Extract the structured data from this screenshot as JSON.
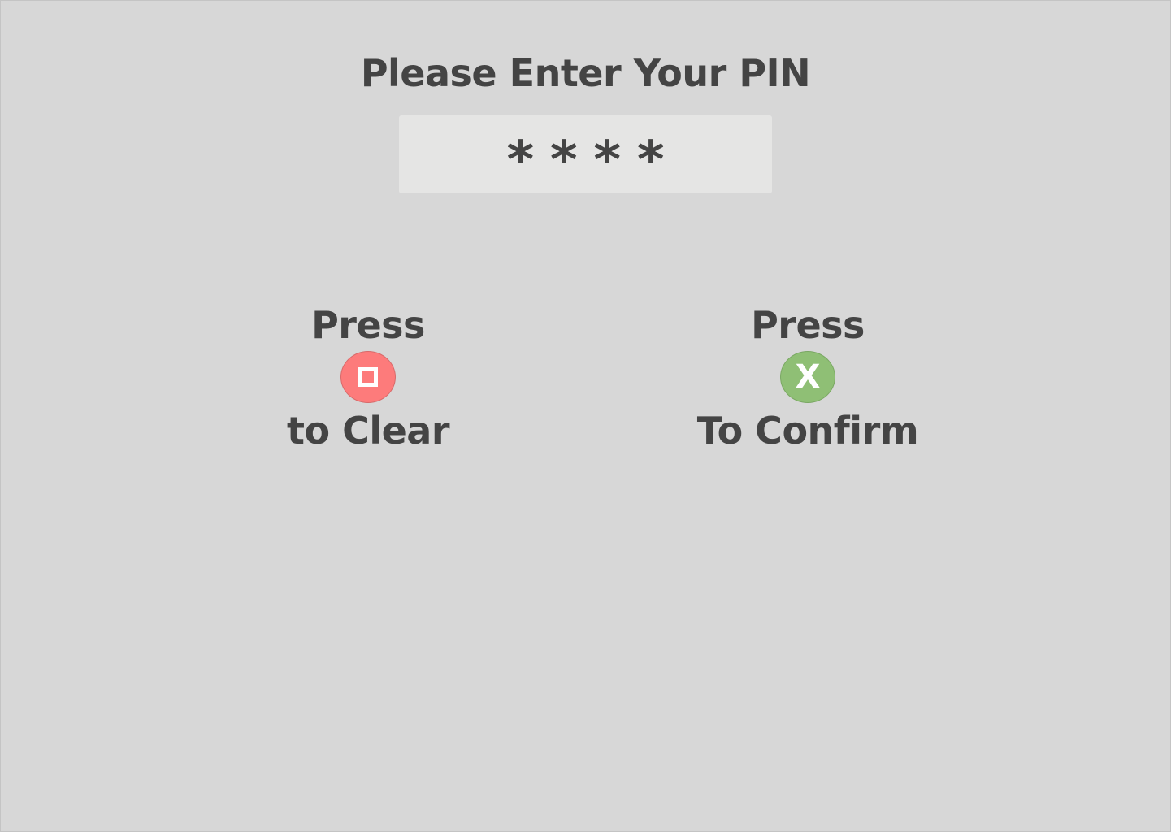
{
  "title": "Please Enter Your PIN",
  "pin": {
    "masked_chars": [
      "*",
      "*",
      "*",
      "*"
    ]
  },
  "clear": {
    "press_label": "Press",
    "result_label": "to Clear",
    "icon": "square-button-icon",
    "color": "#fd7b7b"
  },
  "confirm": {
    "press_label": "Press",
    "button_glyph": "X",
    "result_label": "To Confirm",
    "icon": "cross-button-icon",
    "color": "#8fbf75"
  }
}
